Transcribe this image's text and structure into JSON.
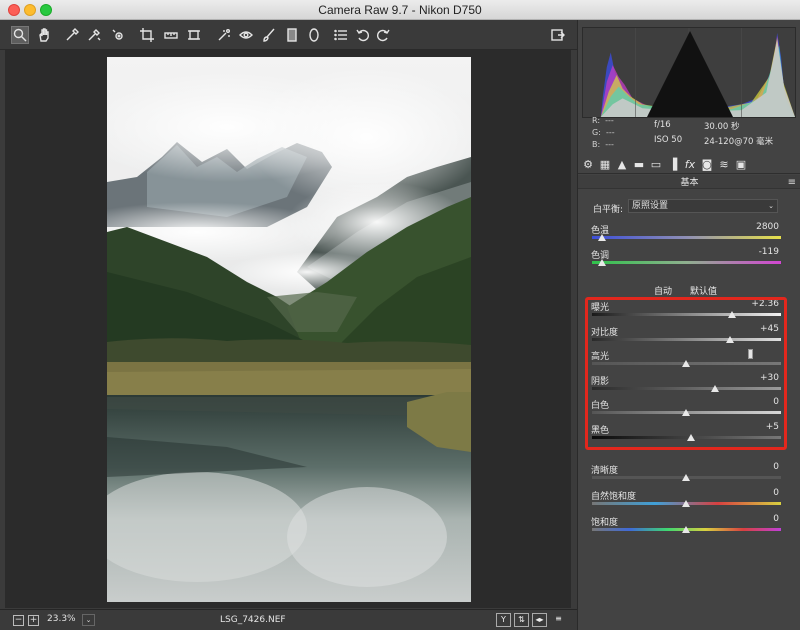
{
  "window": {
    "title": "Camera Raw 9.7 -  Nikon D750"
  },
  "toolbar": {
    "tools": [
      "zoom-tool",
      "hand-tool",
      "white-balance-tool",
      "color-sampler-tool",
      "targeted-adjustment-tool",
      "crop-tool",
      "straighten-tool",
      "transform-tool",
      "spot-removal-tool",
      "red-eye-tool",
      "adjustment-brush-tool",
      "graduated-filter-tool",
      "radial-filter-tool",
      "preferences",
      "rotate-left",
      "rotate-right",
      "toggle-fullscreen"
    ]
  },
  "bottom": {
    "minus": "−",
    "plus": "+",
    "zoom": "23.3%",
    "zoom_arrow": "⌄",
    "filename": "LSG_7426.NEF",
    "icons": [
      "Y",
      "⇅",
      "◂▸",
      "≡"
    ]
  },
  "info": {
    "r_label": "R:",
    "r_value": "---",
    "g_label": "G:",
    "g_value": "---",
    "b_label": "B:",
    "b_value": "---",
    "aperture": "f/16",
    "shutter": "30.00 秒",
    "iso": "ISO 50",
    "lens": "24-120@70 毫米"
  },
  "panel": {
    "title": "基本",
    "menu": "≡",
    "icons": [
      "⚙",
      "▦",
      "▲",
      "▬",
      "▭",
      "▐",
      "fx",
      "◙",
      "≋",
      "▣"
    ]
  },
  "white_balance": {
    "label": "白平衡:",
    "value": "原照设置",
    "arrow": "⌄"
  },
  "temp_tint": [
    {
      "label": "色温",
      "value": "2800",
      "position": 0.06
    },
    {
      "label": "色调",
      "value": "-119",
      "position": 0.06
    }
  ],
  "auto_default": {
    "auto": "自动",
    "default": "默认值"
  },
  "tone": [
    {
      "label": "曝光",
      "value": "+2.36",
      "position": 0.74
    },
    {
      "label": "对比度",
      "value": "+45",
      "position": 0.73
    },
    {
      "label": "高光",
      "value": "",
      "position": 0.5
    },
    {
      "label": "阴影",
      "value": "+30",
      "position": 0.65
    },
    {
      "label": "白色",
      "value": "0",
      "position": 0.5
    },
    {
      "label": "黑色",
      "value": "+5",
      "position": 0.525
    }
  ],
  "presence": [
    {
      "label": "清晰度",
      "value": "0",
      "position": 0.5
    },
    {
      "label": "自然饱和度",
      "value": "0",
      "position": 0.5
    },
    {
      "label": "饱和度",
      "value": "0",
      "position": 0.5
    }
  ],
  "colors": {
    "highlight_border": "#e2271d"
  }
}
